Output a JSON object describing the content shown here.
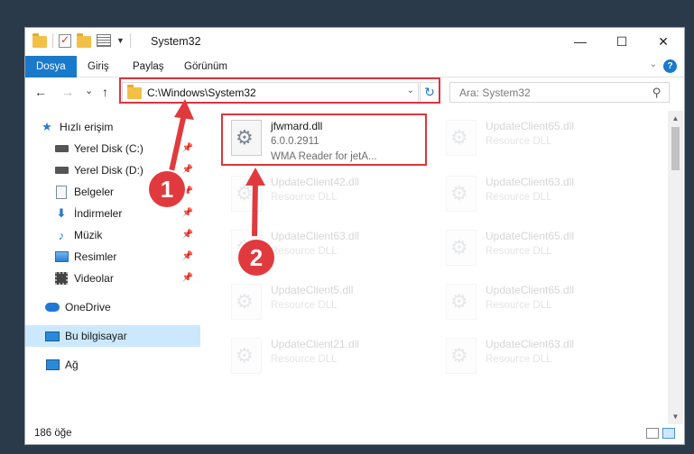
{
  "window": {
    "title": "System32"
  },
  "ribbon": {
    "tabs": [
      "Dosya",
      "Giriş",
      "Paylaş",
      "Görünüm"
    ],
    "active_tab": "Dosya",
    "help": "?"
  },
  "nav": {
    "back": "←",
    "forward": "→",
    "recent": "⌄",
    "up": "↑",
    "address": "C:\\Windows\\System32",
    "refresh": "↻",
    "search_placeholder": "Ara: System32"
  },
  "sidebar": {
    "items": [
      {
        "label": "Hızlı erişim",
        "icon": "star-icon"
      },
      {
        "label": "Yerel Disk (C:)",
        "icon": "drive-icon",
        "pinned": true
      },
      {
        "label": "Yerel Disk (D:)",
        "icon": "drive-icon",
        "pinned": true
      },
      {
        "label": "Belgeler",
        "icon": "documents-icon",
        "pinned": true
      },
      {
        "label": "İndirmeler",
        "icon": "downloads-icon",
        "pinned": true
      },
      {
        "label": "Müzik",
        "icon": "music-icon",
        "pinned": true
      },
      {
        "label": "Resimler",
        "icon": "pictures-icon",
        "pinned": true
      },
      {
        "label": "Videolar",
        "icon": "videos-icon",
        "pinned": true
      },
      {
        "label": "OneDrive",
        "icon": "onedrive-icon"
      },
      {
        "label": "Bu bilgisayar",
        "icon": "this-pc-icon",
        "selected": true
      },
      {
        "label": "Ağ",
        "icon": "network-icon"
      }
    ]
  },
  "files": [
    {
      "name": "jfwmard.dll",
      "type": "6.0.0.2911",
      "desc": "WMA Reader for jetA...",
      "highlighted": true
    },
    {
      "name": "UpdateClient65.dll",
      "type": "Resource DLL"
    },
    {
      "name": "UpdateClient42.dll",
      "type": "Resource DLL"
    },
    {
      "name": "UpdateClient63.dll",
      "type": "Resource DLL"
    },
    {
      "name": "UpdateClient63.dll",
      "type": "Resource DLL"
    },
    {
      "name": "UpdateClient65.dll",
      "type": "Resource DLL"
    },
    {
      "name": "UpdateClient5.dll",
      "type": "Resource DLL"
    },
    {
      "name": "UpdateClient65.dll",
      "type": "Resource DLL"
    },
    {
      "name": "UpdateClient21.dll",
      "type": "Resource DLL"
    },
    {
      "name": "UpdateClient63.dll",
      "type": "Resource DLL"
    }
  ],
  "status": {
    "count": "186 öğe"
  },
  "annotations": {
    "callout1": "1",
    "callout2": "2",
    "color": "#d9363e"
  }
}
